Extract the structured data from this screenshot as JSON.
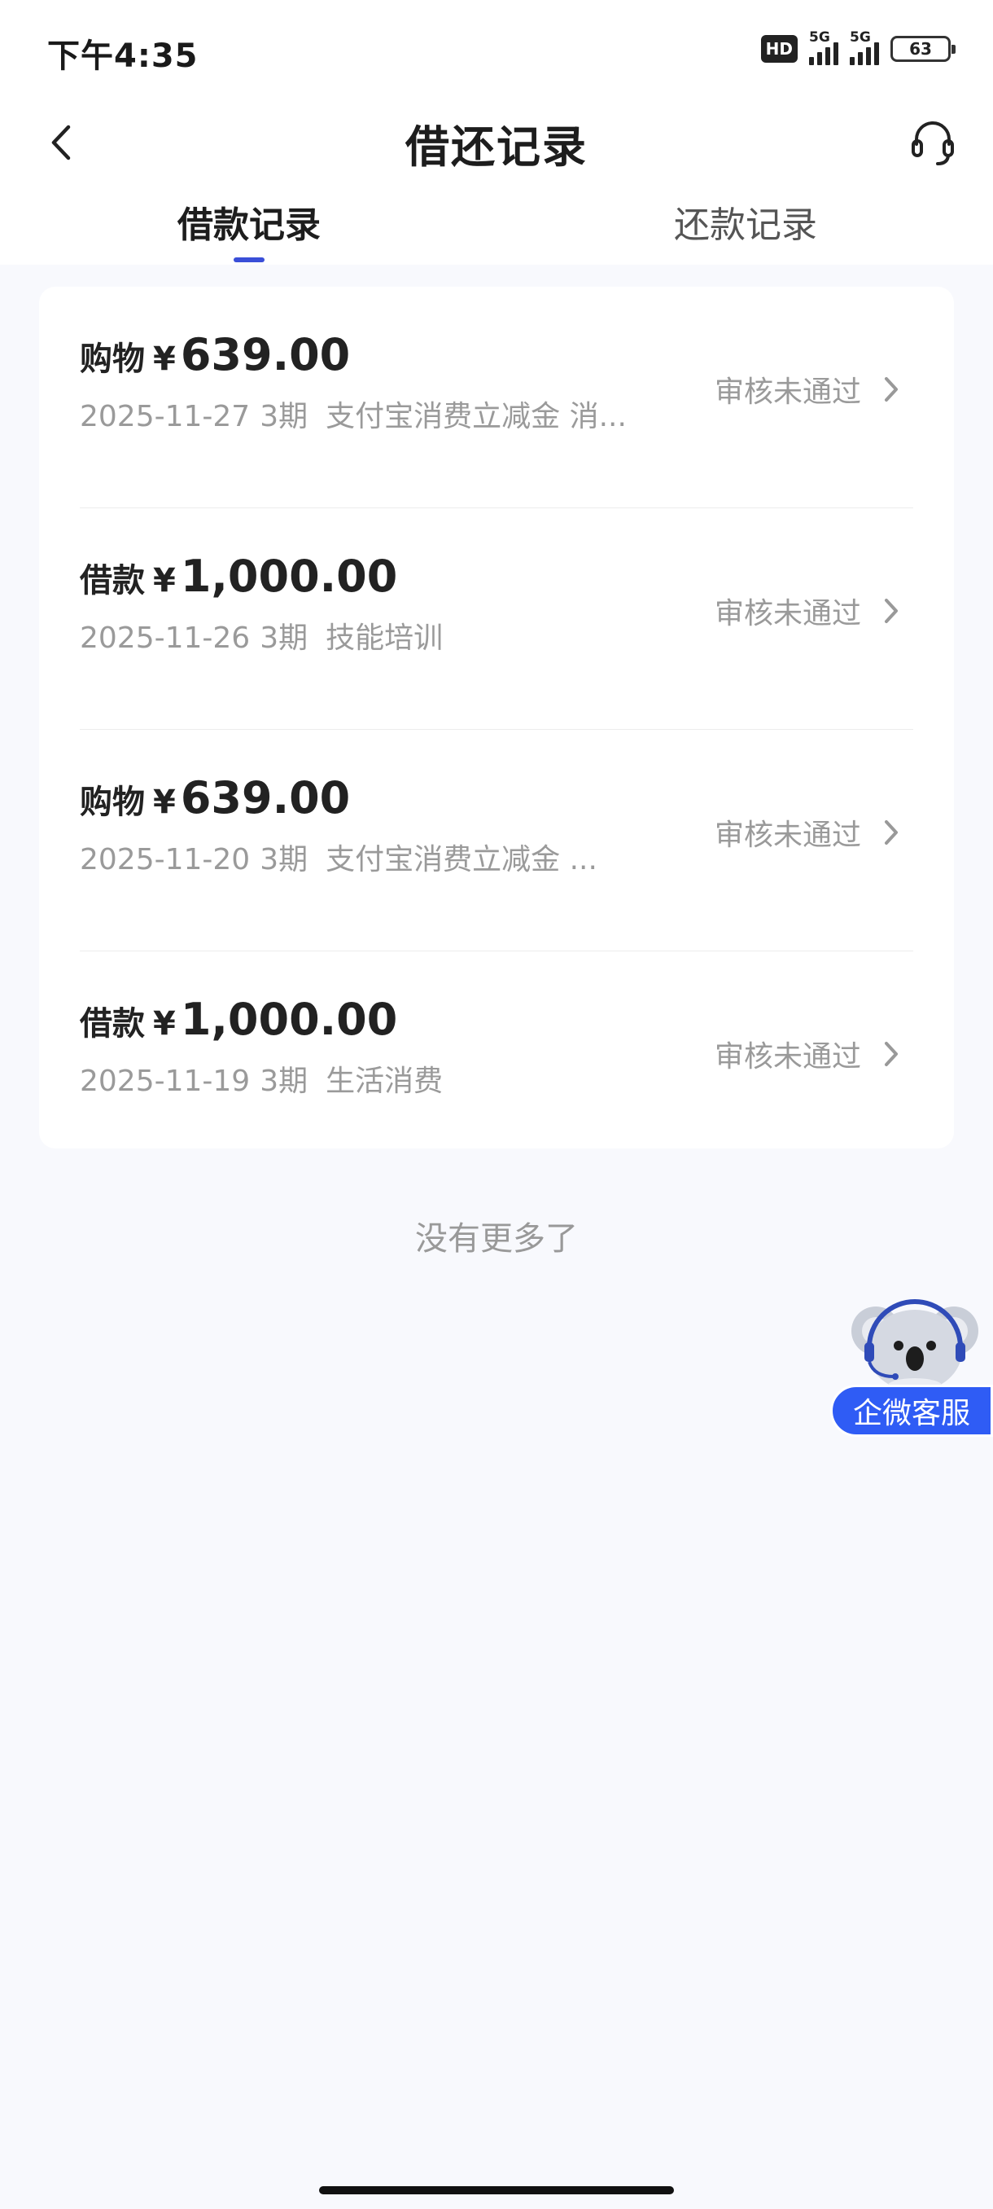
{
  "status_bar": {
    "time": "下午4:35",
    "hd_label": "HD",
    "sim1_label": "5G",
    "sim2_label": "5G",
    "battery": "63"
  },
  "nav": {
    "title": "借还记录",
    "back_icon": "chevron-left-icon",
    "support_icon": "headset-icon"
  },
  "tabs": [
    {
      "label": "借款记录",
      "active": true
    },
    {
      "label": "还款记录",
      "active": false
    }
  ],
  "records": [
    {
      "type": "购物",
      "currency": "¥",
      "amount": "639.00",
      "date": "2025-11-27",
      "term": "3期",
      "purpose": "支付宝消费立减金 消...",
      "status": "审核未通过"
    },
    {
      "type": "借款",
      "currency": "¥",
      "amount": "1,000.00",
      "date": "2025-11-26",
      "term": "3期",
      "purpose": "技能培训",
      "status": "审核未通过"
    },
    {
      "type": "购物",
      "currency": "¥",
      "amount": "639.00",
      "date": "2025-11-20",
      "term": "3期",
      "purpose": "支付宝消费立减金 ...",
      "status": "审核未通过"
    },
    {
      "type": "借款",
      "currency": "¥",
      "amount": "1,000.00",
      "date": "2025-11-19",
      "term": "3期",
      "purpose": "生活消费",
      "status": "审核未通过"
    }
  ],
  "footer_text": "没有更多了",
  "float_service": {
    "label": "企微客服",
    "icon": "koala-mascot-icon"
  },
  "colors": {
    "accent": "#3a4fd8",
    "service_pill": "#2f5cf5",
    "page_bg": "#f8f9fd",
    "muted_text": "#9a9a9a"
  }
}
